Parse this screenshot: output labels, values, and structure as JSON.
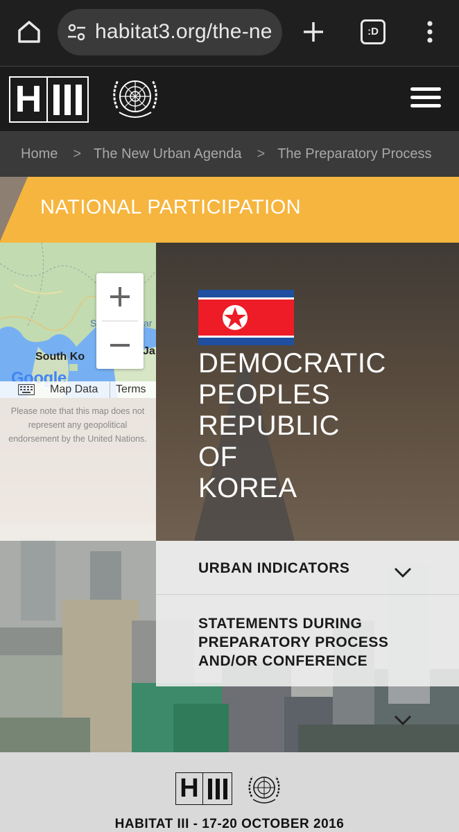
{
  "browser": {
    "url": "habitat3.org/the-ne",
    "tab_icon_label": ":D",
    "icons": [
      "home-icon",
      "tune-icon",
      "plus-icon",
      "tab-switcher-icon",
      "more-vert-icon"
    ]
  },
  "header": {
    "logo_letter": "H",
    "icons": [
      "hiii-logo",
      "un-emblem-icon",
      "hamburger-icon"
    ]
  },
  "breadcrumb": {
    "items": [
      "Home",
      "The New Urban Agenda",
      "The Preparatory Process"
    ],
    "separator": ">"
  },
  "banner": {
    "title": "NATIONAL PARTICIPATION",
    "color": "#f6b53e"
  },
  "map": {
    "labels": [
      "South Ko",
      "Ja",
      "S",
      "ar"
    ],
    "google_wordmark": "Google",
    "map_data_link": "Map Data",
    "terms_link": "Terms",
    "note": "Please note that this map does not represent any geopolitical endorsement by the United Nations."
  },
  "country": {
    "name_lines": [
      "DEMOCRATIC",
      "PEOPLES",
      "REPUBLIC",
      "OF",
      "KOREA"
    ],
    "flag_colors": {
      "blue": "#1e4fa0",
      "red": "#ed1c27",
      "white": "#ffffff"
    }
  },
  "accordion": {
    "items": [
      {
        "label": "URBAN INDICATORS"
      },
      {
        "label": "STATEMENTS DURING\nPREPARATORY PROCESS\nAND/OR CONFERENCE"
      }
    ]
  },
  "footer": {
    "logo_letter": "H",
    "text": "HABITAT III - 17-20 OCTOBER 2016"
  }
}
